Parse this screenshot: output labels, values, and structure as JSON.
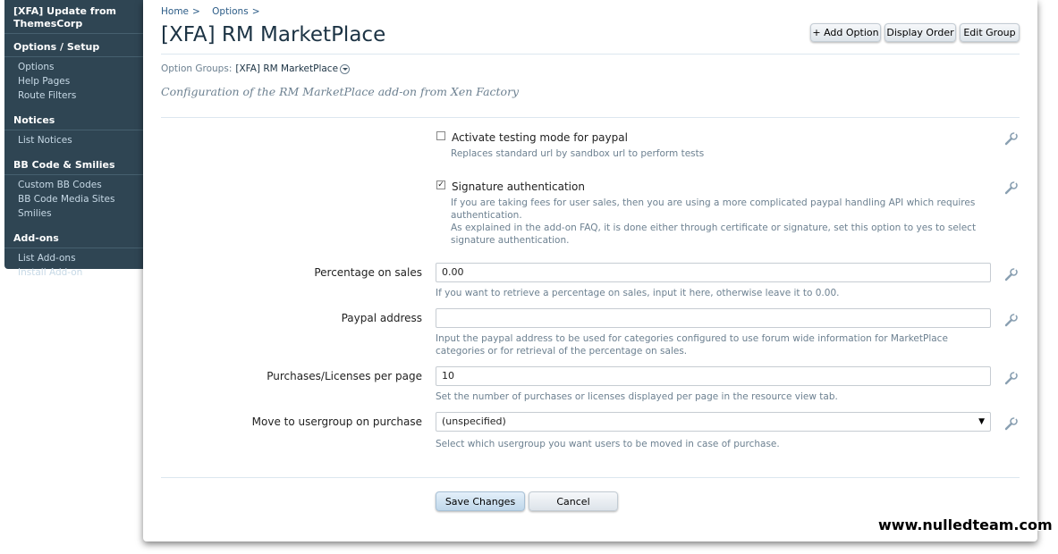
{
  "sidebar": {
    "top_title": "[XFA] Update from ThemesCorp",
    "sections": [
      {
        "heading": "Options / Setup",
        "links": [
          "Options",
          "Help Pages",
          "Route Filters"
        ]
      },
      {
        "heading": "Notices",
        "links": [
          "List Notices"
        ]
      },
      {
        "heading": "BB Code & Smilies",
        "links": [
          "Custom BB Codes",
          "BB Code Media Sites",
          "Smilies"
        ]
      },
      {
        "heading": "Add-ons",
        "links": [
          "List Add-ons",
          "Install Add-on"
        ]
      }
    ]
  },
  "breadcrumb": {
    "home": "Home",
    "options": "Options",
    "separator": ">"
  },
  "page": {
    "title": "[XFA] RM MarketPlace",
    "option_groups_label": "Option Groups:",
    "option_groups_value": "[XFA] RM MarketPlace",
    "description": "Configuration of the RM MarketPlace add-on from Xen Factory"
  },
  "toolbar": {
    "add_option": "+ Add Option",
    "display_order": "Display Order",
    "edit_group": "Edit Group"
  },
  "options": {
    "testing_mode": {
      "checked": false,
      "label": "Activate testing mode for paypal",
      "hint": "Replaces standard url by sandbox url to perform tests"
    },
    "signature_auth": {
      "checked": true,
      "label": "Signature authentication",
      "hint1": "If you are taking fees for user sales, then you are using a more complicated paypal handling API which requires authentication.",
      "hint2": "As explained in the add-on FAQ, it is done either through certificate or signature, set this option to yes to select signature authentication."
    },
    "percentage": {
      "label": "Percentage on sales",
      "value": "0.00",
      "hint": "If you want to retrieve a percentage on sales, input it here, otherwise leave it to 0.00."
    },
    "paypal_address": {
      "label": "Paypal address",
      "value": "",
      "hint": "Input the paypal address to be used for categories configured to use forum wide information for MarketPlace categories or for retrieval of the percentage on sales."
    },
    "per_page": {
      "label": "Purchases/Licenses per page",
      "value": "10",
      "hint": "Set the number of purchases or licenses displayed per page in the resource view tab."
    },
    "usergroup": {
      "label": "Move to usergroup on purchase",
      "value": "(unspecified)",
      "hint": "Select which usergroup you want users to be moved in case of purchase."
    }
  },
  "actions": {
    "save": "Save Changes",
    "cancel": "Cancel"
  },
  "watermark": "www.nulledteam.com",
  "colors": {
    "sidebar_bg": "#2f4553",
    "link": "#2b5b86",
    "title": "#1c3344",
    "hint": "#6d8191"
  }
}
